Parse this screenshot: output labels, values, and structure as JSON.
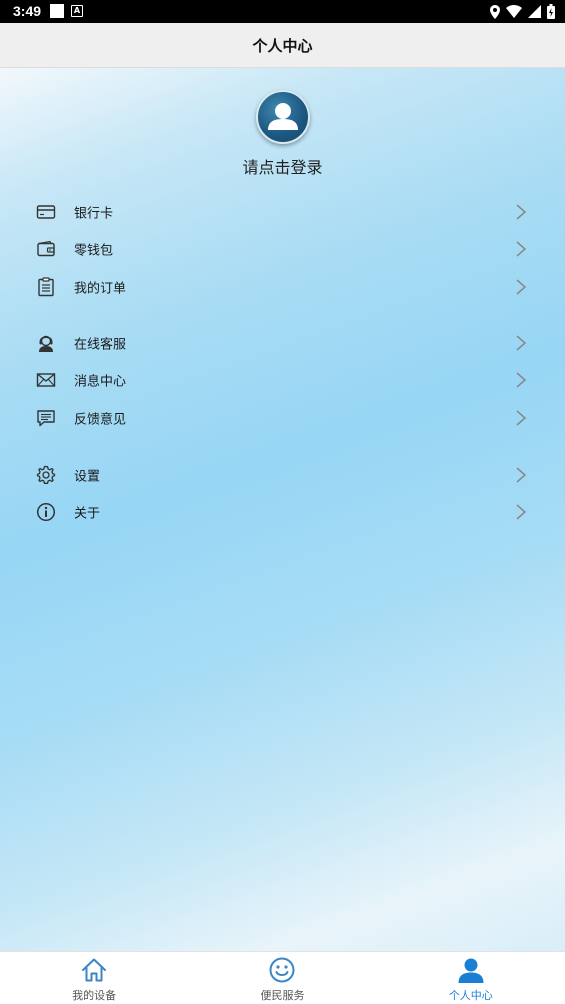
{
  "status_bar": {
    "time": "3:49",
    "notif_letter": "A"
  },
  "title_bar": {
    "title": "个人中心"
  },
  "profile": {
    "login_prompt": "请点击登录"
  },
  "menu": {
    "group1": [
      {
        "label": "银行卡",
        "icon": "bank-card-icon"
      },
      {
        "label": "零钱包",
        "icon": "wallet-icon"
      },
      {
        "label": "我的订单",
        "icon": "order-clipboard-icon"
      }
    ],
    "group2": [
      {
        "label": "在线客服",
        "icon": "customer-service-icon"
      },
      {
        "label": "消息中心",
        "icon": "envelope-icon"
      },
      {
        "label": "反馈意见",
        "icon": "feedback-chat-icon"
      }
    ],
    "group3": [
      {
        "label": "设置",
        "icon": "gear-icon"
      },
      {
        "label": "关于",
        "icon": "info-icon"
      }
    ]
  },
  "bottom_nav": {
    "items": [
      {
        "label": "我的设备",
        "icon": "home-icon",
        "active": false
      },
      {
        "label": "便民服务",
        "icon": "smiley-icon",
        "active": false
      },
      {
        "label": "个人中心",
        "icon": "person-icon",
        "active": true
      }
    ],
    "active_color": "#1a7fd4",
    "icon_color": "#3a86c8"
  }
}
